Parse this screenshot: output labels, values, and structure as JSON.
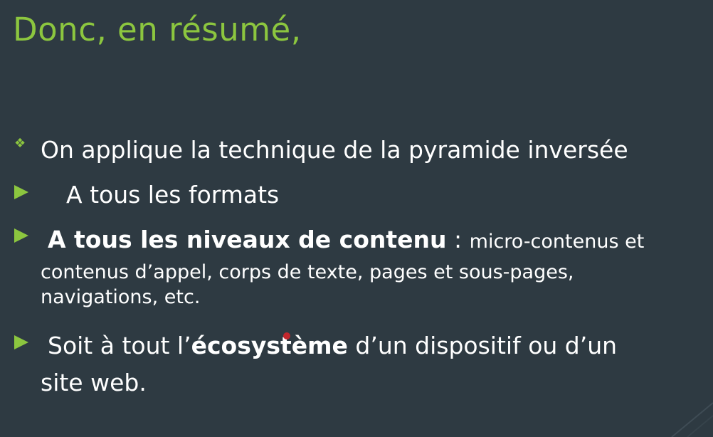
{
  "slide": {
    "title": "Donc, en résumé,",
    "bullets": [
      {
        "marker": "diamond-bullet-icon",
        "text": "On applique la technique de la pyramide inversée"
      },
      {
        "marker": "triangle-bullet-icon",
        "text": "A tous les formats"
      },
      {
        "marker": "triangle-bullet-icon",
        "bold": "A tous les niveaux de contenu",
        "sep": " : ",
        "small": "micro-contenus et",
        "rest": [
          "contenus d’appel, corps de texte, pages et sous-pages,",
          "navigations, etc."
        ]
      },
      {
        "marker": "triangle-bullet-icon",
        "pre": "Soit à tout l’",
        "bold": "écosystème",
        "post": " d’un dispositif ou d’un",
        "line2": "site web."
      }
    ]
  },
  "colors": {
    "background": "#2e3a42",
    "accent": "#8cc63f",
    "text": "#ffffff",
    "laser_pointer": "#c1272d"
  }
}
